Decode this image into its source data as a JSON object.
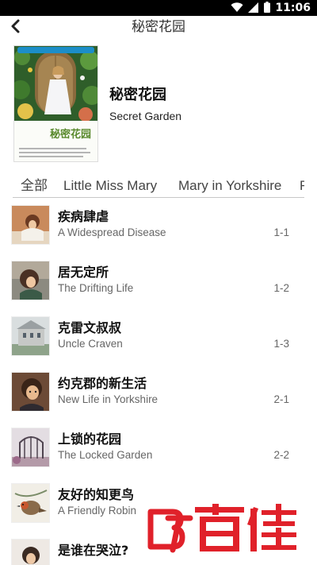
{
  "status_bar": {
    "time": "11:06",
    "icons": [
      "wifi-icon",
      "signal-icon",
      "battery-icon"
    ]
  },
  "app_bar": {
    "title": "秘密花园",
    "back_icon": "back-arrow-icon"
  },
  "book": {
    "title_cn": "秘密花园",
    "title_en": "Secret Garden",
    "cover_title": "秘密花园"
  },
  "tabs": [
    {
      "label": "全部",
      "selected": true
    },
    {
      "label": "Little Miss Mary",
      "selected": false
    },
    {
      "label": "Mary in Yorkshire",
      "selected": false
    },
    {
      "label": "F",
      "selected": false
    }
  ],
  "chapters": [
    {
      "title": "疾病肆虐",
      "subtitle": "A Widespread Disease",
      "number": "1-1"
    },
    {
      "title": "居无定所",
      "subtitle": "The Drifting Life",
      "number": "1-2"
    },
    {
      "title": "克雷文叔叔",
      "subtitle": "Uncle Craven",
      "number": "1-3"
    },
    {
      "title": "约克郡的新生活",
      "subtitle": "New Life in Yorkshire",
      "number": "2-1"
    },
    {
      "title": "上锁的花园",
      "subtitle": "The Locked Garden",
      "number": "2-2"
    },
    {
      "title": "友好的知更鸟",
      "subtitle": "A Friendly Robin",
      "number": ""
    },
    {
      "title": "是谁在哭泣?",
      "subtitle": "",
      "number": ""
    }
  ],
  "watermark": {
    "text": "百佳"
  },
  "colors": {
    "watermark_red": "#e0212a",
    "cover_green": "#5a8a2e",
    "accent_blue": "#1c8ec8"
  }
}
